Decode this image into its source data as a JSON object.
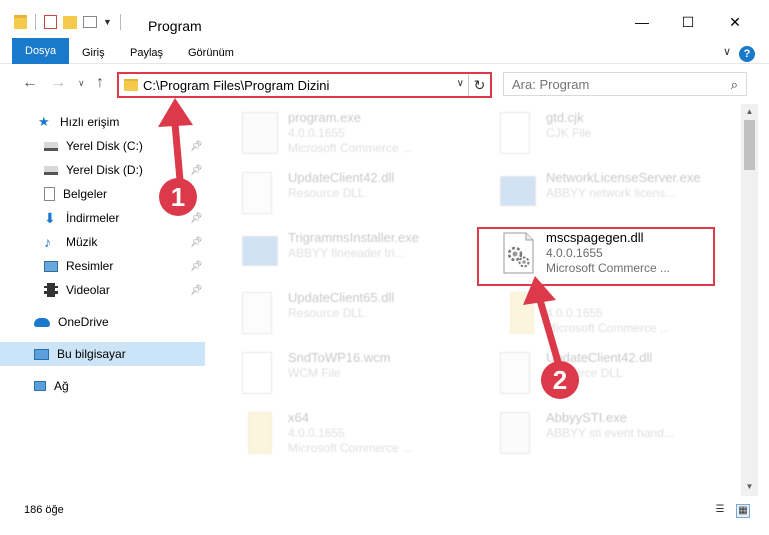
{
  "window": {
    "title": "Program"
  },
  "ribbon": {
    "tabs": [
      "Dosya",
      "Giriş",
      "Paylaş",
      "Görünüm"
    ],
    "help": "?"
  },
  "address": {
    "path": "C:\\Program Files\\Program Dizini"
  },
  "search": {
    "placeholder": "Ara: Program"
  },
  "sidebar": {
    "quick_access": "Hızlı erişim",
    "items": [
      "Yerel Disk (C:)",
      "Yerel Disk (D:)",
      "Belgeler",
      "İndirmeler",
      "Müzik",
      "Resimler",
      "Videolar"
    ],
    "onedrive": "OneDrive",
    "this_pc": "Bu bilgisayar",
    "network": "Ağ"
  },
  "files": [
    {
      "name": "program.exe",
      "line2": "4.0.0.1655",
      "line3": "Microsoft Commerce ..."
    },
    {
      "name": "gtd.cjk",
      "line2": "CJK File",
      "line3": ""
    },
    {
      "name": "UpdateClient42.dll",
      "line2": "Resource DLL",
      "line3": ""
    },
    {
      "name": "NetworkLicenseServer.exe",
      "line2": "ABBYY network licens...",
      "line3": ""
    },
    {
      "name": "TrigrammsInstaller.exe",
      "line2": "ABBYY fineeader tri...",
      "line3": ""
    },
    {
      "name": "mscspagegen.dll",
      "line2": "4.0.0.1655",
      "line3": "Microsoft Commerce ..."
    },
    {
      "name": "UpdateClient65.dll",
      "line2": "Resource DLL",
      "line3": ""
    },
    {
      "name": "",
      "line2": "4.0.0.1655",
      "line3": "Microsoft Commerce ..."
    },
    {
      "name": "SndToWP16.wcm",
      "line2": "WCM File",
      "line3": ""
    },
    {
      "name": "UpdateClient42.dll",
      "line2": "Resource DLL",
      "line3": ""
    },
    {
      "name": "x64",
      "line2": "4.0.0.1655",
      "line3": "Microsoft Commerce ..."
    },
    {
      "name": "AbbyySTI.exe",
      "line2": "ABBYY sti event hand...",
      "line3": ""
    }
  ],
  "status": {
    "count": "186 öğe"
  },
  "callouts": [
    "1",
    "2"
  ],
  "colors": {
    "accent": "#1979ca",
    "highlight": "#dc3a4a",
    "selected": "#cce4f7"
  }
}
